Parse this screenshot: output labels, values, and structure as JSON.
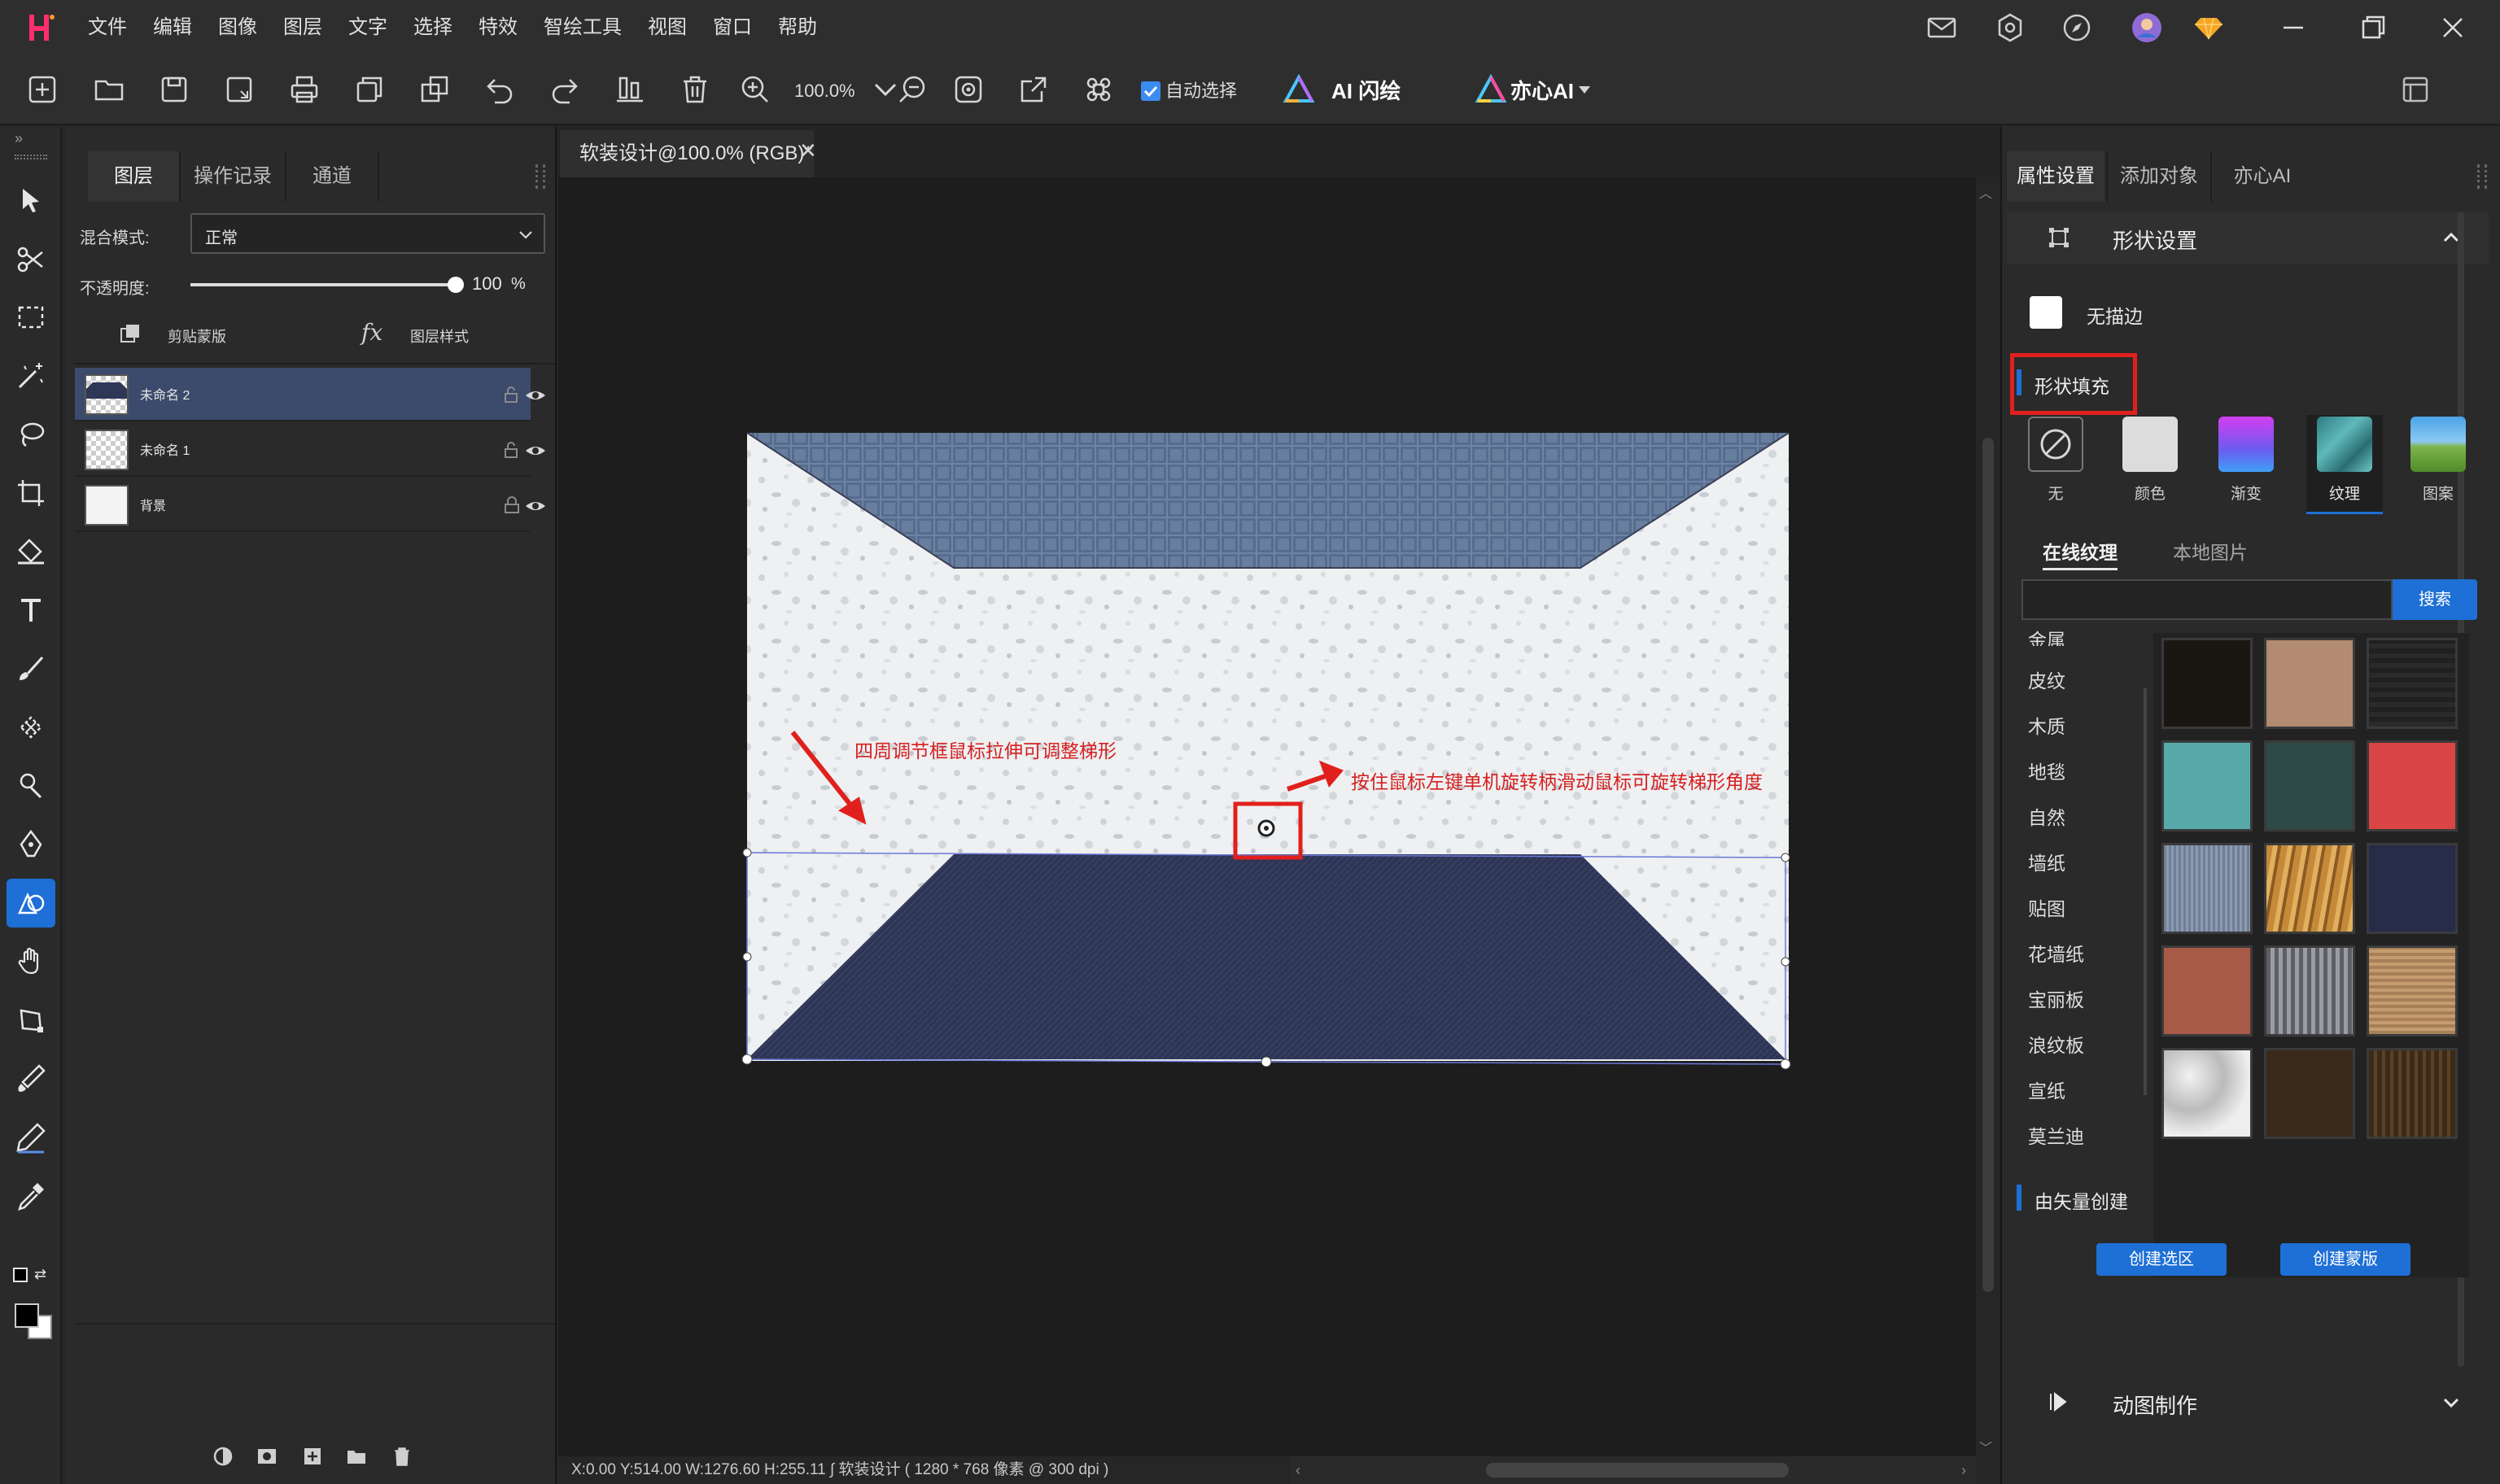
{
  "menu": [
    "文件",
    "编辑",
    "图像",
    "图层",
    "文字",
    "选择",
    "特效",
    "智绘工具",
    "视图",
    "窗口",
    "帮助"
  ],
  "toolbar": {
    "zoom": "100.0%",
    "auto_select": "自动选择",
    "ai_flash": "AI 闪绘",
    "yixin_ai": "亦心AI"
  },
  "layers_panel": {
    "tabs": [
      "图层",
      "操作记录",
      "通道"
    ],
    "blend_label": "混合模式:",
    "blend_value": "正常",
    "opacity_label": "不透明度:",
    "opacity_value": "100",
    "opacity_unit": "%",
    "clip_mask": "剪贴蒙版",
    "layer_style": "图层样式",
    "layers": [
      {
        "name": "未命名 2"
      },
      {
        "name": "未命名 1"
      },
      {
        "name": "背景"
      }
    ]
  },
  "document": {
    "tab_title": "软装设计@100.0% (RGB)*",
    "annotation_left": "四周调节框鼠标拉伸可调整梯形",
    "annotation_right": "按住鼠标左键单机旋转柄滑动鼠标可旋转梯形角度",
    "status": "X:0.00 Y:514.00 W:1276.60 H:255.11 ∫   软装设计 ( 1280 * 768 像素 @ 300 dpi )"
  },
  "right_panel": {
    "tabs": [
      "属性设置",
      "添加对象",
      "亦心AI"
    ],
    "section_title": "形状设置",
    "no_stroke": "无描边",
    "fill_title": "形状填充",
    "fill_options": [
      "无",
      "颜色",
      "渐变",
      "纹理",
      "图案"
    ],
    "subtabs": [
      "在线纹理",
      "本地图片"
    ],
    "search_button": "搜索",
    "categories": [
      "金属",
      "皮纹",
      "木质",
      "地毯",
      "自然",
      "墙纸",
      "贴图",
      "花墙纸",
      "宝丽板",
      "浪纹板",
      "宣纸",
      "莫兰迪"
    ],
    "vector_title": "由矢量创建",
    "create_selection": "创建选区",
    "create_mask": "创建蒙版",
    "animation": "动图制作"
  },
  "colors": {
    "accent": "#1e6fd6",
    "highlight_box": "#e0201c",
    "trapezoid_fill": "#2f3756",
    "layer_selected": "#3c4a6b"
  }
}
